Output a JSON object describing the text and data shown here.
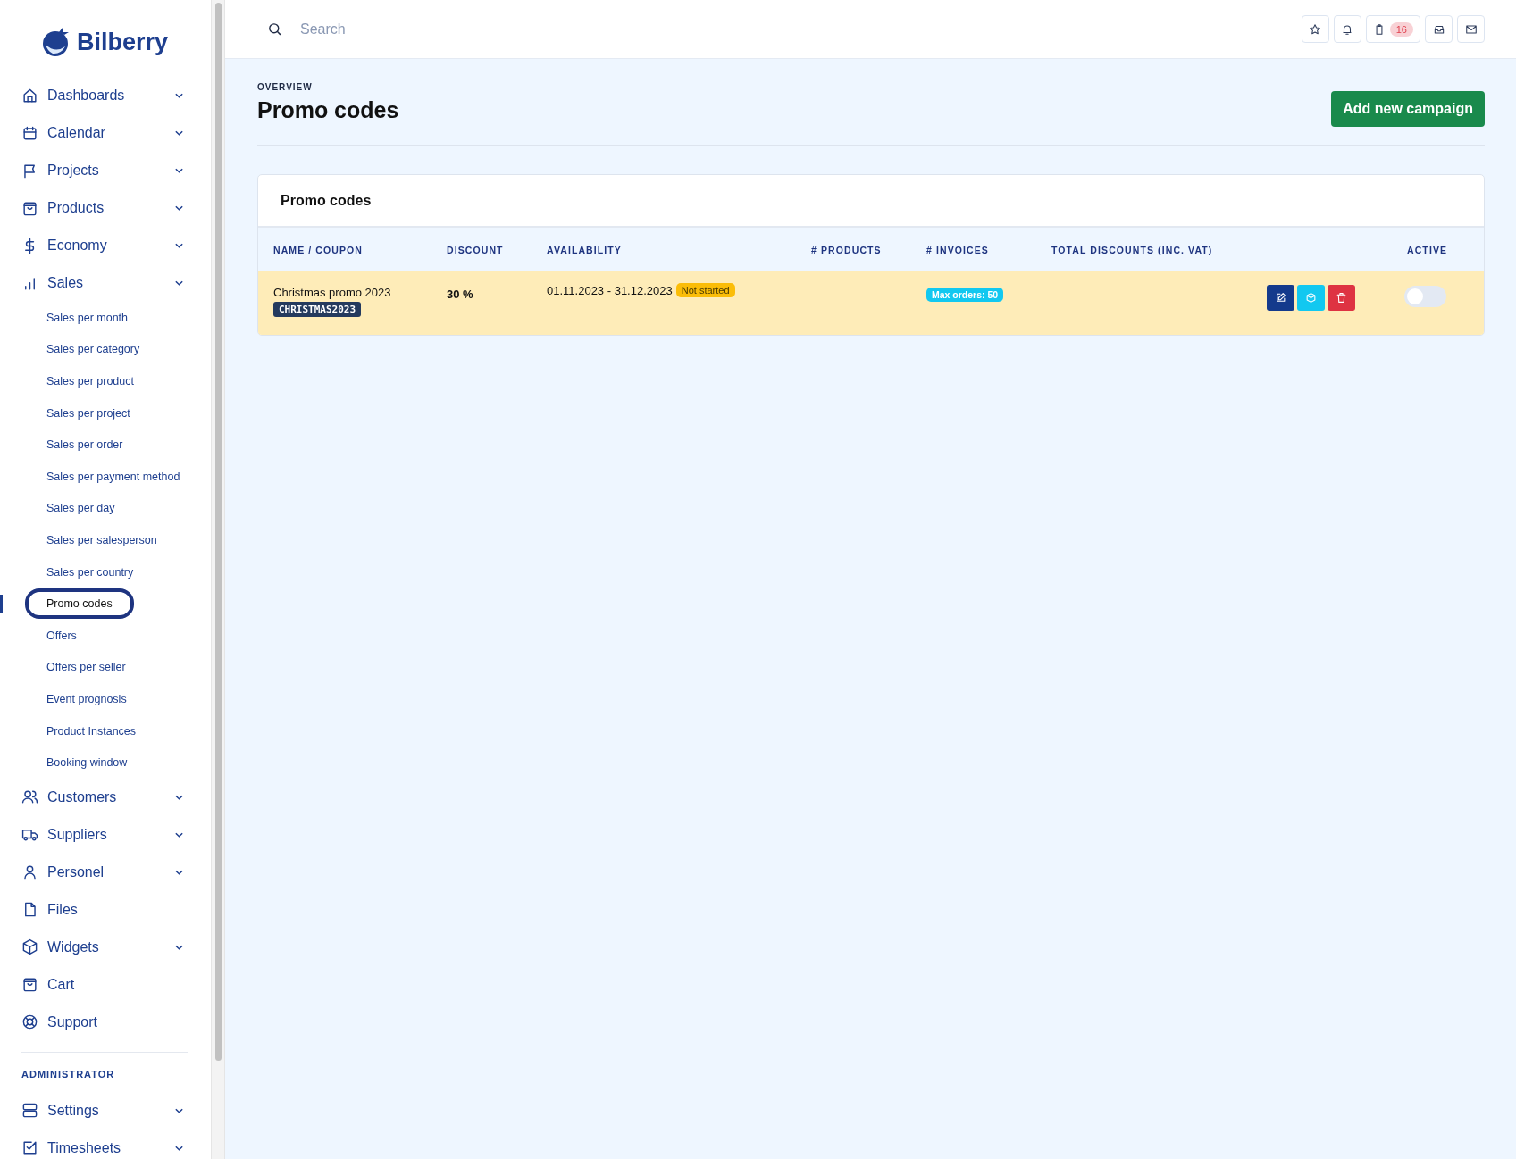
{
  "sidebar": {
    "logo": "Bilberry",
    "items": [
      {
        "label": "Dashboards",
        "kind": "home",
        "expandable": true
      },
      {
        "label": "Calendar",
        "kind": "calendar",
        "expandable": true
      },
      {
        "label": "Projects",
        "kind": "flag",
        "expandable": true
      },
      {
        "label": "Products",
        "kind": "bag",
        "expandable": true
      },
      {
        "label": "Economy",
        "kind": "dollar",
        "expandable": true
      },
      {
        "label": "Sales",
        "kind": "chart",
        "expandable": true,
        "children": [
          {
            "label": "Sales per month",
            "selected": false
          },
          {
            "label": "Sales per category",
            "selected": false
          },
          {
            "label": "Sales per product",
            "selected": false
          },
          {
            "label": "Sales per project",
            "selected": false
          },
          {
            "label": "Sales per order",
            "selected": false
          },
          {
            "label": "Sales per payment method",
            "selected": false
          },
          {
            "label": "Sales per day",
            "selected": false
          },
          {
            "label": "Sales per salesperson",
            "selected": false
          },
          {
            "label": "Sales per country",
            "selected": false
          },
          {
            "label": "Promo codes",
            "selected": true
          },
          {
            "label": "Offers",
            "selected": false
          },
          {
            "label": "Offers per seller",
            "selected": false
          },
          {
            "label": "Event prognosis",
            "selected": false
          },
          {
            "label": "Product Instances",
            "selected": false
          },
          {
            "label": "Booking window",
            "selected": false
          }
        ]
      },
      {
        "label": "Customers",
        "kind": "users",
        "expandable": true
      },
      {
        "label": "Suppliers",
        "kind": "truck",
        "expandable": true
      },
      {
        "label": "Personel",
        "kind": "user",
        "expandable": true
      },
      {
        "label": "Files",
        "kind": "file",
        "expandable": false
      },
      {
        "label": "Widgets",
        "kind": "cube",
        "expandable": true
      },
      {
        "label": "Cart",
        "kind": "bag",
        "expandable": false
      },
      {
        "label": "Support",
        "kind": "lifebuoy",
        "expandable": false
      }
    ],
    "section_title": "ADMINISTRATOR",
    "admin_items": [
      {
        "label": "Settings",
        "kind": "server",
        "expandable": true
      },
      {
        "label": "Timesheets",
        "kind": "check",
        "expandable": true
      }
    ]
  },
  "topbar": {
    "search": {
      "placeholder": "Search"
    },
    "buttons": [
      {
        "kind": "star"
      },
      {
        "kind": "bell"
      },
      {
        "kind": "clipboard",
        "badge": "16"
      },
      {
        "kind": "inbox"
      },
      {
        "kind": "mail"
      }
    ]
  },
  "header": {
    "eyebrow": "OVERVIEW",
    "title": "Promo codes",
    "action": "Add new campaign"
  },
  "card": {
    "title": "Promo codes",
    "table": {
      "columns": [
        "NAME / COUPON",
        "DISCOUNT",
        "AVAILABILITY",
        "# PRODUCTS",
        "# INVOICES",
        "TOTAL DISCOUNTS (INC. VAT)",
        "ACTIVE"
      ],
      "rows": [
        {
          "name": "Christmas promo 2023",
          "coupon": "CHRISTMAS2023",
          "discount": "30 %",
          "availability": "01.11.2023 - 31.12.2023",
          "status": "Not started",
          "invoices": "Max orders: 50",
          "highlighted": true,
          "actions": [
            {
              "kind": "edit"
            },
            {
              "kind": "box"
            },
            {
              "kind": "delete"
            }
          ],
          "active": false
        }
      ]
    }
  }
}
